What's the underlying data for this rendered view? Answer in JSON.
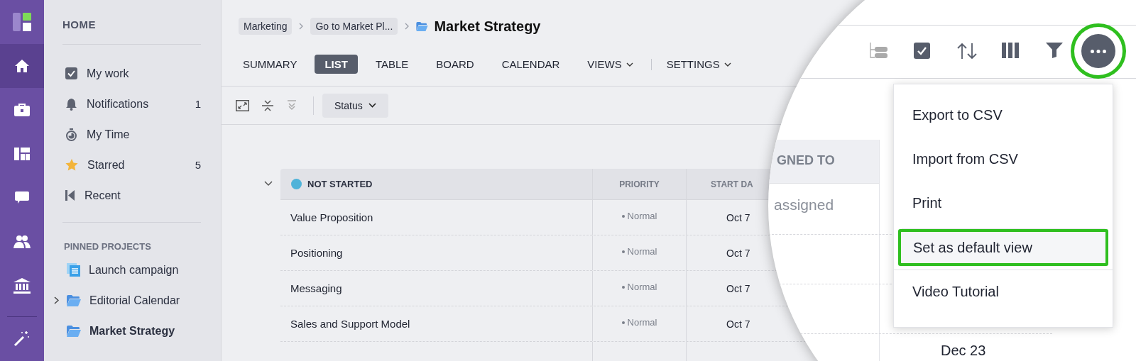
{
  "rail": {
    "items": [
      {
        "kind": "home",
        "selected": true,
        "divider_before": false
      },
      {
        "kind": "briefcase",
        "selected": false,
        "divider_before": false
      },
      {
        "kind": "dashboard",
        "selected": false,
        "divider_before": false
      },
      {
        "kind": "chat",
        "selected": false,
        "divider_before": false
      },
      {
        "kind": "people",
        "selected": false,
        "divider_before": false
      },
      {
        "kind": "bank",
        "selected": false,
        "divider_before": false
      },
      {
        "kind": "wand",
        "selected": false,
        "divider_before": true
      }
    ]
  },
  "sidebar": {
    "title": "HOME",
    "items": [
      {
        "label": "My work",
        "kind": "check"
      },
      {
        "label": "Notifications",
        "kind": "bell",
        "count": "1"
      },
      {
        "label": "My Time",
        "kind": "timer"
      },
      {
        "label": "Starred",
        "kind": "star",
        "count": "5"
      },
      {
        "label": "Recent",
        "kind": "recent"
      }
    ],
    "pinned_title": "PINNED PROJECTS",
    "pinned": [
      {
        "label": "Launch campaign",
        "kind": "list",
        "expandable": false,
        "selected": false
      },
      {
        "label": "Editorial Calendar",
        "kind": "folder",
        "expandable": true,
        "selected": false
      },
      {
        "label": "Market Strategy",
        "kind": "folder",
        "expandable": false,
        "selected": true
      }
    ]
  },
  "breadcrumbs": [
    "Marketing",
    "Go to Market Pl..."
  ],
  "title": "Market Strategy",
  "tabs": [
    {
      "label": "SUMMARY",
      "selected": false,
      "dropdown": false,
      "divider_before": false
    },
    {
      "label": "LIST",
      "selected": true,
      "dropdown": false,
      "divider_before": false
    },
    {
      "label": "TABLE",
      "selected": false,
      "dropdown": false,
      "divider_before": false
    },
    {
      "label": "BOARD",
      "selected": false,
      "dropdown": false,
      "divider_before": false
    },
    {
      "label": "CALENDAR",
      "selected": false,
      "dropdown": false,
      "divider_before": false
    },
    {
      "label": "VIEWS",
      "selected": false,
      "dropdown": true,
      "divider_before": false
    },
    {
      "label": "SETTINGS",
      "selected": false,
      "dropdown": true,
      "divider_before": true
    }
  ],
  "toolbar": {
    "group_by": "Status"
  },
  "group": {
    "status": "NOT STARTED",
    "color": "#4fb3d9",
    "expanded": true,
    "columns": [
      "PRIORITY",
      "START DA"
    ],
    "rows": [
      {
        "name": "Value Proposition",
        "priority": "Normal",
        "start": "Oct 7"
      },
      {
        "name": "Positioning",
        "priority": "Normal",
        "start": "Oct 7"
      },
      {
        "name": "Messaging",
        "priority": "Normal",
        "start": "Oct 7"
      },
      {
        "name": "Sales and Support Model",
        "priority": "Normal",
        "start": "Oct 7"
      }
    ]
  },
  "magnifier": {
    "column": "GNED TO",
    "assignee": "assigned",
    "date": "Dec 23",
    "more_highlighted": true,
    "menu": [
      {
        "label": "Export to CSV",
        "selected": false,
        "divider_before": false
      },
      {
        "label": "Import from CSV",
        "selected": false,
        "divider_before": false
      },
      {
        "label": "Print",
        "selected": false,
        "divider_before": false
      },
      {
        "label": "Set as default view",
        "selected": true,
        "divider_before": true
      },
      {
        "label": "Video Tutorial",
        "selected": false,
        "divider_before": true
      }
    ]
  }
}
